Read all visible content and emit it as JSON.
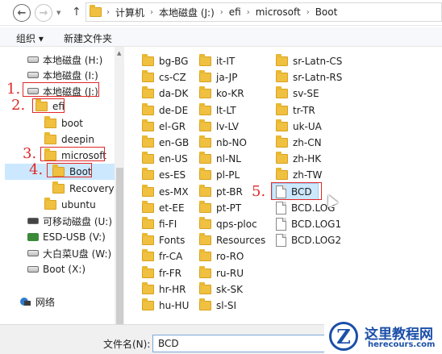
{
  "nav_buttons": {
    "back": "←",
    "forward": "→",
    "up": "↑"
  },
  "address": {
    "segments": [
      "计算机",
      "本地磁盘 (J:)",
      "efi",
      "microsoft",
      "Boot"
    ]
  },
  "toolbar": {
    "organize": "组织 ▾",
    "new_folder": "新建文件夹"
  },
  "sidebar": {
    "items": [
      {
        "label": "本地磁盘 (H:)",
        "icon": "drive"
      },
      {
        "label": "本地磁盘 (I:)",
        "icon": "drive"
      },
      {
        "label": "本地磁盘 (J:)",
        "icon": "drive"
      },
      {
        "label": "efi",
        "icon": "folder"
      },
      {
        "label": "boot",
        "icon": "folder"
      },
      {
        "label": "deepin",
        "icon": "folder"
      },
      {
        "label": "microsoft",
        "icon": "folder"
      },
      {
        "label": "Boot",
        "icon": "folder"
      },
      {
        "label": "Recovery",
        "icon": "folder"
      },
      {
        "label": "ubuntu",
        "icon": "folder"
      },
      {
        "label": "可移动磁盘 (U:)",
        "icon": "drive"
      },
      {
        "label": "ESD-USB (V:)",
        "icon": "usb"
      },
      {
        "label": "大白菜U盘 (W:)",
        "icon": "drive"
      },
      {
        "label": "Boot (X:)",
        "icon": "drive"
      },
      {
        "label": "网络",
        "icon": "network"
      }
    ]
  },
  "steps": [
    "1.",
    "2.",
    "3.",
    "4.",
    "5."
  ],
  "files": {
    "col1": [
      "bg-BG",
      "cs-CZ",
      "da-DK",
      "de-DE",
      "el-GR",
      "en-GB",
      "en-US",
      "es-ES",
      "es-MX",
      "et-EE",
      "fi-FI",
      "Fonts",
      "fr-CA",
      "fr-FR",
      "hr-HR",
      "hu-HU"
    ],
    "col2": [
      "it-IT",
      "ja-JP",
      "ko-KR",
      "lt-LT",
      "lv-LV",
      "nb-NO",
      "nl-NL",
      "pl-PL",
      "pt-BR",
      "pt-PT",
      "qps-ploc",
      "Resources",
      "ro-RO",
      "ru-RU",
      "sk-SK",
      "sl-SI"
    ],
    "col3_folders": [
      "sr-Latn-CS",
      "sr-Latn-RS",
      "sv-SE",
      "tr-TR",
      "uk-UA",
      "zh-CN",
      "zh-HK",
      "zh-TW"
    ],
    "col3_files": [
      "BCD",
      "BCD.LOG",
      "BCD.LOG1",
      "BCD.LOG2"
    ]
  },
  "filename": {
    "label": "文件名(N):",
    "value": "BCD"
  },
  "watermark": {
    "title": "这里教程网",
    "url": "herecours.com",
    "logo": "Z"
  }
}
